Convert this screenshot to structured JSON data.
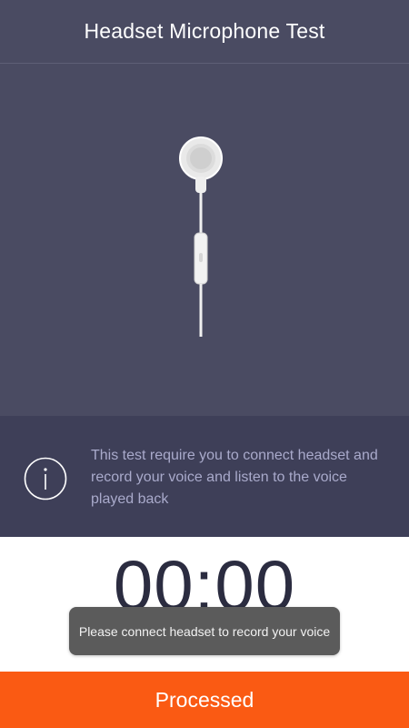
{
  "header": {
    "title": "Headset Microphone Test"
  },
  "hero": {
    "image": "earphone-image"
  },
  "info": {
    "icon": "info-icon",
    "text": "This test require you to connect headset and record your voice and listen to the voice played back"
  },
  "timer": {
    "value": "00:00"
  },
  "toast": {
    "message": "Please connect headset to record your voice"
  },
  "action": {
    "label": "Processed"
  },
  "colors": {
    "header_bg": "#4a4b62",
    "info_bg": "#3e3f58",
    "accent": "#fa5a13",
    "timer_text": "#2b2c40"
  }
}
